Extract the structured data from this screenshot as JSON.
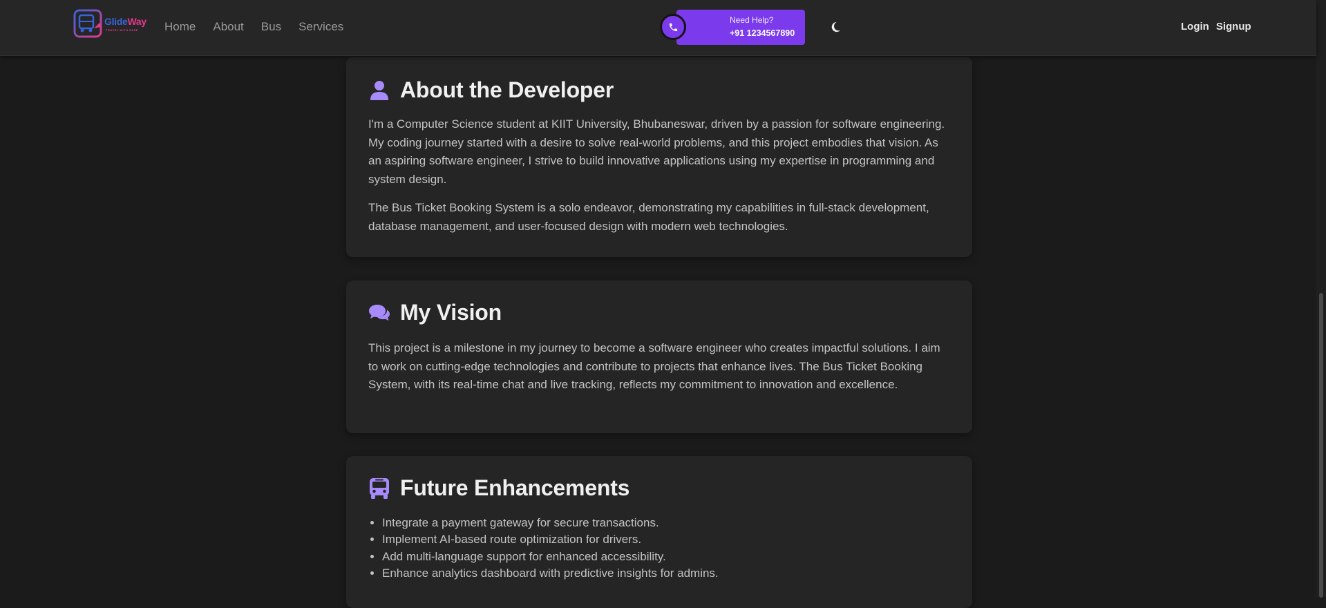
{
  "brand": {
    "name_part1": "Glide",
    "name_part2": "Way",
    "tagline": "TRAVEL WITH EASE"
  },
  "nav": {
    "links": [
      "Home",
      "About",
      "Bus",
      "Services"
    ]
  },
  "help": {
    "title": "Need Help?",
    "phone": "+91 1234567890"
  },
  "auth": {
    "login": "Login",
    "signup": "Signup"
  },
  "sections": {
    "developer": {
      "icon": "user-icon",
      "title": "About the Developer",
      "paragraphs": [
        "I'm a Computer Science student at KIIT University, Bhubaneswar, driven by a passion for software engineering. My coding journey started with a desire to solve real-world problems, and this project embodies that vision. As an aspiring software engineer, I strive to build innovative applications using my expertise in programming and system design.",
        "The Bus Ticket Booking System is a solo endeavor, demonstrating my capabilities in full-stack development, database management, and user-focused design with modern web technologies."
      ]
    },
    "vision": {
      "icon": "chat-icon",
      "title": "My Vision",
      "paragraph": "This project is a milestone in my journey to become a software engineer who creates impactful solutions. I aim to work on cutting-edge technologies and contribute to projects that enhance lives. The Bus Ticket Booking System, with its real-time chat and live tracking, reflects my commitment to innovation and excellence."
    },
    "future": {
      "icon": "bus-icon",
      "title": "Future Enhancements",
      "items": [
        "Integrate a payment gateway for secure transactions.",
        "Implement AI-based route optimization for drivers.",
        "Add multi-language support for enhanced accessibility.",
        "Enhance analytics dashboard with predictive insights for admins."
      ]
    }
  },
  "colors": {
    "accent": "#7c3aed",
    "icon_accent": "#a78bfa",
    "background": "#1b1b1b",
    "card": "#252525",
    "navbar": "#262626"
  }
}
